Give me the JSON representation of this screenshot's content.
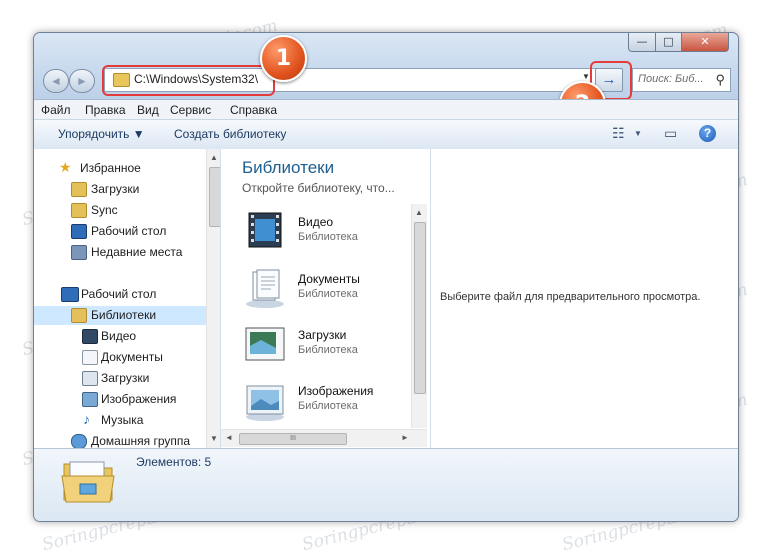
{
  "window": {
    "controls": {
      "minimize": "—",
      "maximize": "□",
      "close": "✕"
    },
    "nav": {
      "back_icon": "◄",
      "forward_icon": "►"
    },
    "address": {
      "value": "C:\\Windows\\System32\\",
      "dropdown_icon": "▼",
      "go_icon": "→"
    },
    "search": {
      "placeholder": "Поиск: Биб...",
      "icon": "⚲"
    },
    "badges": [
      "1",
      "2"
    ]
  },
  "menu": [
    "Файл",
    "Правка",
    "Вид",
    "Сервис",
    "Справка"
  ],
  "toolbar": {
    "organize": "Упорядочить ▼",
    "new_library": "Создать библиотеку",
    "views_icon": "☷",
    "views_dropdown": "▼",
    "pane_icon": "▭",
    "help_icon": "?"
  },
  "sidebar": {
    "favorites": {
      "label": "Избранное",
      "items": [
        "Загрузки",
        "Sync",
        "Рабочий стол",
        "Недавние места"
      ]
    },
    "desktop": "Рабочий стол",
    "libraries": {
      "label": "Библиотеки",
      "items": [
        "Видео",
        "Документы",
        "Загрузки",
        "Изображения",
        "Музыка"
      ]
    },
    "homegroup": "Домашняя группа",
    "scroll_up": "▲",
    "scroll_down": "▼"
  },
  "libraries_pane": {
    "title": "Библиотеки",
    "subtitle": "Откройте библиотеку, что...",
    "items": [
      {
        "name": "Видео",
        "type": "Библиотека"
      },
      {
        "name": "Документы",
        "type": "Библиотека"
      },
      {
        "name": "Загрузки",
        "type": "Библиотека"
      },
      {
        "name": "Изображения",
        "type": "Библиотека"
      }
    ],
    "hscroll": {
      "left": "◄",
      "right": "►",
      "grip": "III"
    }
  },
  "preview": {
    "text": "Выберите файл для предварительного просмотра."
  },
  "details": {
    "count_text": "Элементов: 5"
  },
  "watermark": "Soringpcrepair.com",
  "colors": {
    "highlight": "#e53b3b",
    "badge": "#e0531d",
    "selected": "#cde8ff"
  }
}
